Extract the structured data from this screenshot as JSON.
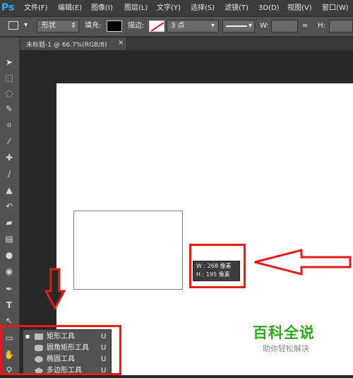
{
  "app": {
    "logo": "Ps"
  },
  "menu": {
    "items": [
      "文件(F)",
      "编辑(E)",
      "图像(I)",
      "图层(L)",
      "文字(Y)",
      "选择(S)",
      "滤镜(T)",
      "3D(D)",
      "视图(V)",
      "窗口(W)"
    ]
  },
  "options": {
    "mode_value": "形状",
    "fill_label": "填充:",
    "stroke_label": "描边:",
    "stroke_size_value": "3 点",
    "width_label": "W:",
    "height_label": "H:"
  },
  "document_tab": {
    "title": "未标题-1 @ 66.7%(RGB/8)",
    "close_glyph": "×"
  },
  "tooltip": {
    "width_line": "W : 268 像素",
    "height_line": "H : 195 像素"
  },
  "flyout": {
    "items": [
      {
        "label": "矩形工具",
        "shortcut": "U",
        "selected": true,
        "icon": "rectangle-icon"
      },
      {
        "label": "圆角矩形工具",
        "shortcut": "U",
        "selected": false,
        "icon": "rounded-rectangle-icon"
      },
      {
        "label": "椭圆工具",
        "shortcut": "U",
        "selected": false,
        "icon": "ellipse-icon"
      },
      {
        "label": "多边形工具",
        "shortcut": "U",
        "selected": false,
        "icon": "polygon-icon"
      }
    ],
    "selected_marker": "▪"
  },
  "watermark": {
    "title": "百科全说",
    "subtitle": "助你轻松解决"
  },
  "colors": {
    "annotation_red": "#e41b1b",
    "watermark_green": "#2fa81e",
    "ps_blue": "#31a8ff"
  }
}
